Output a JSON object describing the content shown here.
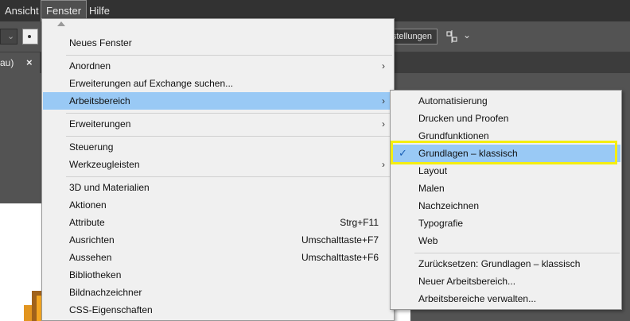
{
  "menubar": {
    "items": [
      {
        "label": "Ansicht"
      },
      {
        "label": "Fenster"
      },
      {
        "label": "Hilfe"
      }
    ]
  },
  "controlbar": {
    "button_label": "stellungen"
  },
  "doc_tab": {
    "title": "au)",
    "close_glyph": "×"
  },
  "menu": {
    "items": [
      {
        "label": "Neues Fenster"
      },
      {
        "label": "Anordnen"
      },
      {
        "label": "Erweiterungen auf Exchange suchen..."
      },
      {
        "label": "Arbeitsbereich"
      },
      {
        "label": "Erweiterungen"
      },
      {
        "label": "Steuerung"
      },
      {
        "label": "Werkzeugleisten"
      },
      {
        "label": "3D und Materialien"
      },
      {
        "label": "Aktionen"
      },
      {
        "label": "Attribute",
        "shortcut": "Strg+F11"
      },
      {
        "label": "Ausrichten",
        "shortcut": "Umschalttaste+F7"
      },
      {
        "label": "Aussehen",
        "shortcut": "Umschalttaste+F6"
      },
      {
        "label": "Bibliotheken"
      },
      {
        "label": "Bildnachzeichner"
      },
      {
        "label": "CSS-Eigenschaften"
      }
    ]
  },
  "submenu": {
    "items": [
      {
        "label": "Automatisierung"
      },
      {
        "label": "Drucken und Proofen"
      },
      {
        "label": "Grundfunktionen"
      },
      {
        "label": "Grundlagen – klassisch",
        "checked": true
      },
      {
        "label": "Layout"
      },
      {
        "label": "Malen"
      },
      {
        "label": "Nachzeichnen"
      },
      {
        "label": "Typografie"
      },
      {
        "label": "Web"
      },
      {
        "label": "Zurücksetzen: Grundlagen – klassisch"
      },
      {
        "label": "Neuer Arbeitsbereich..."
      },
      {
        "label": "Arbeitsbereiche verwalten..."
      }
    ]
  },
  "icons": {
    "submenu_arrow": "›",
    "checkmark": "✓",
    "chevron_down": "⌄"
  },
  "colors": {
    "highlight": "#99c9f5",
    "annotation_frame": "#f5ee10"
  }
}
